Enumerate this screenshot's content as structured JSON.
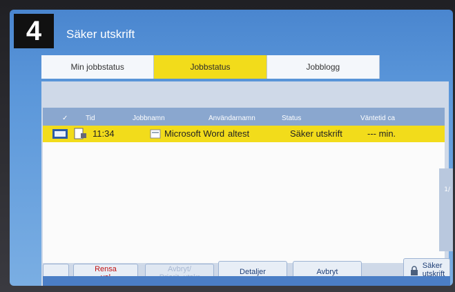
{
  "step": {
    "number": "4"
  },
  "header": {
    "title": "Säker utskrift"
  },
  "tabs": [
    {
      "label": "Min jobbstatus"
    },
    {
      "label": "Jobbstatus"
    },
    {
      "label": "Jobblogg"
    }
  ],
  "table": {
    "columns": {
      "select": "✓",
      "tid": "Tid",
      "jobbnamn": "Jobbnamn",
      "anvandarnamn": "Användarnamn",
      "status": "Status",
      "vantetid": "Väntetid ca"
    },
    "row": {
      "tid": "11:34",
      "jobbnamn": "Microsoft Word",
      "anvandarnamn": "altest",
      "status": "Säker utskrift",
      "vantetid": "--- min."
    }
  },
  "footer": {
    "rensa_line1": "Rensa",
    "rensa_line2": "val",
    "avbryt_prioritet_line1": "Avbryt/",
    "avbryt_prioritet_line2": "Priorit. utskr",
    "detaljer": "Detaljer",
    "avbryt": "Avbryt",
    "saker_line1": "Säker",
    "saker_line2": "utskrift"
  },
  "side_indicator": {
    "value": "1/"
  },
  "colors": {
    "accent": "#f2dc1b",
    "screen_blue": "#5b97da",
    "header_blue": "#8aa7cf"
  },
  "icons": [
    "app-icon",
    "queue-icon",
    "document-lock-icon",
    "document-icon",
    "lock-icon"
  ]
}
